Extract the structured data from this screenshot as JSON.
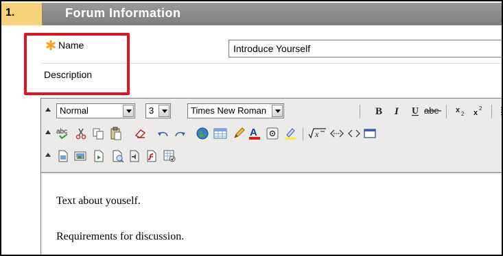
{
  "section": {
    "number": "1.",
    "title": "Forum Information"
  },
  "form": {
    "name_label": "Name",
    "name_value": "Introduce Yourself",
    "description_label": "Description"
  },
  "toolbar": {
    "style_select": "Normal",
    "size_select": "3",
    "font_select": "Times New Roman",
    "row1_buttons": [
      "bold-icon",
      "italic-icon",
      "underline-icon",
      "strikethrough-icon",
      "subscript-icon",
      "superscript-icon"
    ],
    "row2_buttons": [
      "spellcheck-icon",
      "cut-icon",
      "copy-icon",
      "paste-icon",
      "clear-format-icon",
      "undo-icon",
      "redo-icon",
      "link-icon",
      "table-icon",
      "pencil-icon",
      "text-color-icon",
      "special-char-icon",
      "highlight-icon",
      "math-icon",
      "preview-icon",
      "html-icon",
      "fullscreen-icon"
    ],
    "row3_buttons": [
      "insert-file-icon",
      "insert-image-icon",
      "insert-media-icon",
      "mashup-icon",
      "audio-icon",
      "flash-icon",
      "spreadsheet-icon"
    ]
  },
  "editor": {
    "paragraphs": [
      "Text about youself.",
      "Requirements for discussion."
    ]
  },
  "colors": {
    "header_bg": "#8a8a8a",
    "step_bg": "#f6d37b",
    "highlight": "#e0141a",
    "asterisk": "#f4a21c"
  }
}
